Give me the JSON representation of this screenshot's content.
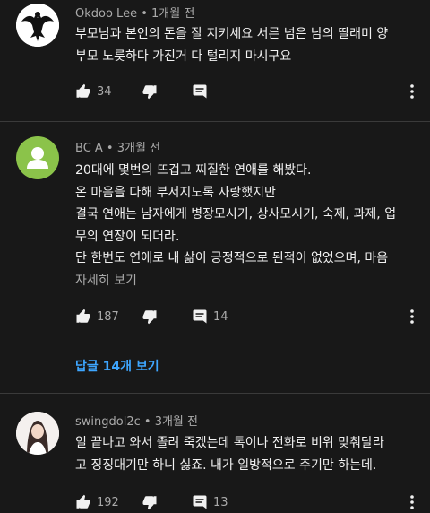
{
  "comments": [
    {
      "author": "Okdoo Lee",
      "time": "1개월 전",
      "lines": [
        "부모님과 본인의 돈을 잘 지키세요 서른 넘은 남의 딸래미 양",
        "부모 노릇하다 가진거 다 털리지 마시구요"
      ],
      "likes": "34",
      "replies_count": ""
    },
    {
      "author": "BC A",
      "time": "3개월 전",
      "lines": [
        "20대에 몇번의 뜨겁고 찌질한 연애를 해봤다.",
        "온 마음을 다해 부서지도록 사랑했지만",
        "결국 연애는 남자에게 병장모시기, 상사모시기, 숙제, 과제, 업",
        "무의 연장이 되더라.",
        "단 한번도 연애로 내 삶이 긍정적으로 된적이 없었으며, 마음"
      ],
      "read_more": "자세히 보기",
      "likes": "187",
      "replies_count": "14",
      "view_replies": "답글 14개 보기"
    },
    {
      "author": "swingdol2c",
      "time": "3개월 전",
      "lines": [
        "일 끝나고 와서 졸려 죽겠는데 톡이나 전화로 비위 맞춰달라",
        "고 징징대기만 하니 싫죠. 내가 일방적으로 주기만 하는데."
      ],
      "likes": "192",
      "replies_count": "13"
    }
  ],
  "separator": " • ",
  "colors": {
    "background": "#181818",
    "text": "#f1f1f1",
    "secondary": "#aaaaaa",
    "link": "#3ea6ff"
  }
}
